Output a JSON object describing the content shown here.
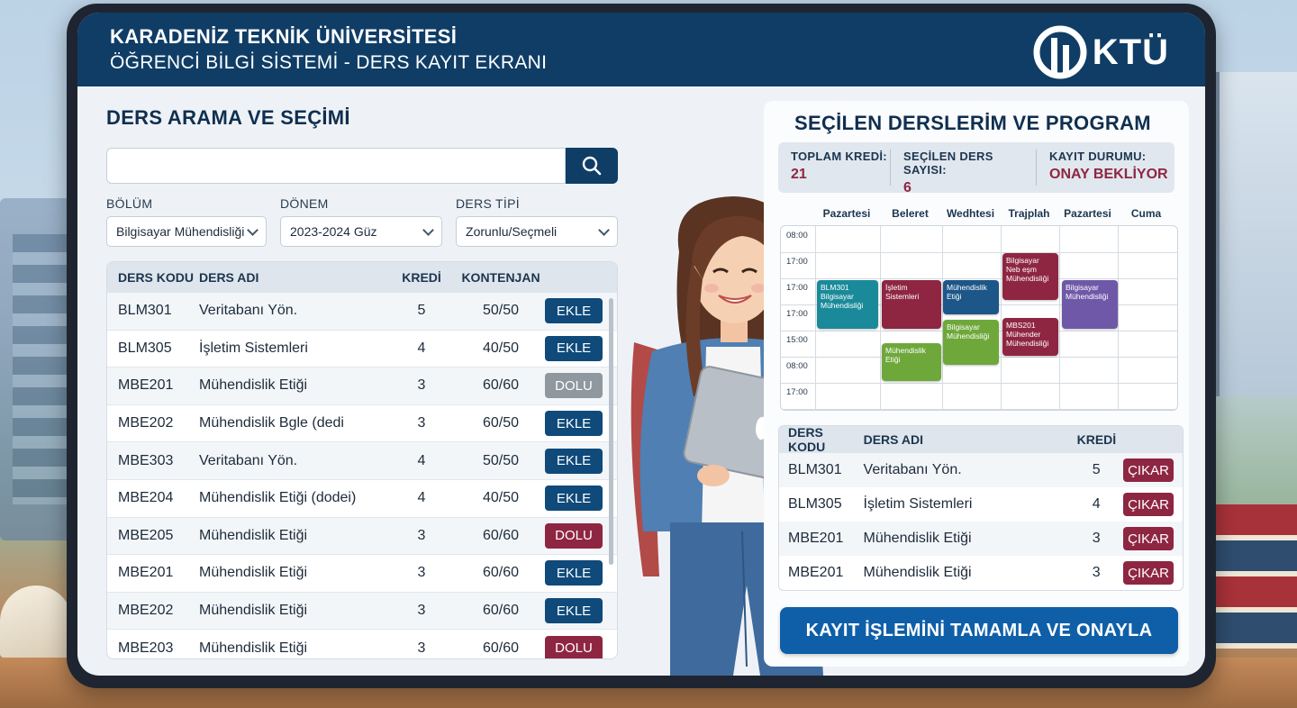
{
  "header": {
    "university": "KARADENİZ TEKNİK ÜNİVERSİTESİ",
    "system": "ÖĞRENCİ BİLGİ SİSTEMİ - DERS KAYIT EKRANI",
    "logo_text": "KTÜ"
  },
  "search_section": {
    "title": "DERS ARAMA VE SEÇİMİ",
    "search_value": "",
    "search_icon": "search-icon"
  },
  "filters": [
    {
      "label": "BÖLÜM",
      "value": "Bilgisayar Mühendisliği"
    },
    {
      "label": "DÖNEM",
      "value": "2023-2024 Güz"
    },
    {
      "label": "DERS TİPİ",
      "value": "Zorunlu/Seçmeli"
    }
  ],
  "course_table": {
    "headers": {
      "code": "DERS KODU",
      "name": "DERS ADI",
      "credit": "KREDİ",
      "quota": "KONTENJAN"
    },
    "rows": [
      {
        "code": "BLM301",
        "name": "Veritabanı Yön.",
        "credit": "5",
        "quota": "50/50",
        "action": "EKLE",
        "status": "add"
      },
      {
        "code": "BLM305",
        "name": "İşletim Sistemleri",
        "credit": "4",
        "quota": "40/50",
        "action": "EKLE",
        "status": "add"
      },
      {
        "code": "MBE201",
        "name": "Mühendislik Etiği",
        "credit": "3",
        "quota": "60/60",
        "action": "DOLU",
        "status": "full-gray"
      },
      {
        "code": "MBE202",
        "name": "Mühendislik Bgle (dedi",
        "credit": "3",
        "quota": "60/50",
        "action": "EKLE",
        "status": "add"
      },
      {
        "code": "MBE303",
        "name": "Veritabanı Yön.",
        "credit": "4",
        "quota": "50/50",
        "action": "EKLE",
        "status": "add"
      },
      {
        "code": "MBE204",
        "name": "Mühendislik Etiği (dodei)",
        "credit": "4",
        "quota": "40/50",
        "action": "EKLE",
        "status": "add"
      },
      {
        "code": "MBE205",
        "name": "Mühendislik Etiği",
        "credit": "3",
        "quota": "60/60",
        "action": "DOLU",
        "status": "full-red"
      },
      {
        "code": "MBE201",
        "name": "Mühendislik Etiği",
        "credit": "3",
        "quota": "60/60",
        "action": "EKLE",
        "status": "add"
      },
      {
        "code": "MBE202",
        "name": "Mühendislik Etiği",
        "credit": "3",
        "quota": "60/60",
        "action": "EKLE",
        "status": "add"
      },
      {
        "code": "MBE203",
        "name": "Mühendislik Etiği",
        "credit": "3",
        "quota": "60/60",
        "action": "DOLU",
        "status": "full-red"
      }
    ]
  },
  "selected_section": {
    "title": "SEÇİLEN DERSLERİM VE PROGRAM",
    "summary": [
      {
        "label": "TOPLAM KREDİ:",
        "value": "21"
      },
      {
        "label": "SEÇİLEN DERS SAYISI:",
        "value": "6"
      },
      {
        "label": "KAYIT DURUMU:",
        "value": "ONAY BEKLİYOR"
      }
    ]
  },
  "schedule": {
    "days": [
      "Pazartesi",
      "Beleret",
      "Wedhtesi",
      "Trajplah",
      "Pazartesi",
      "Cuma"
    ],
    "times": [
      "08:00",
      "17:00",
      "17:00",
      "17:00",
      "15:00",
      "08:00",
      "17:00"
    ],
    "blocks": [
      {
        "lines": [
          "BLM301",
          "Bilgisayar",
          "Mühendisliği"
        ],
        "color": "#1a8a9a"
      },
      {
        "lines": [
          "İşletim",
          "Sistemleri"
        ],
        "color": "#8e2642"
      },
      {
        "lines": [
          "Mühendislik",
          "Etiği"
        ],
        "color": "#6fa83a"
      },
      {
        "lines": [
          "Mühendislik",
          "Etiği"
        ],
        "color": "#1d5688"
      },
      {
        "lines": [
          "Bilgisayar",
          "Mühendisliği"
        ],
        "color": "#6fa83a"
      },
      {
        "lines": [
          "Bilgisayar",
          "Neb eşm",
          "Mühendisliği"
        ],
        "color": "#8e2642"
      },
      {
        "lines": [
          "MBS201",
          "Mühender",
          "Mühendisliği"
        ],
        "color": "#8e2642"
      },
      {
        "lines": [
          "Bilgisayar",
          "Mühendisliği"
        ],
        "color": "#7058a8"
      }
    ]
  },
  "selected_table": {
    "headers": {
      "code": "DERS KODU",
      "name": "DERS ADI",
      "credit": "KREDİ"
    },
    "rows": [
      {
        "code": "BLM301",
        "name": "Veritabanı Yön.",
        "credit": "5",
        "action": "ÇIKAR"
      },
      {
        "code": "BLM305",
        "name": "İşletim Sistemleri",
        "credit": "4",
        "action": "ÇIKAR"
      },
      {
        "code": "MBE201",
        "name": "Mühendislik Etiği",
        "credit": "3",
        "action": "ÇIKAR"
      },
      {
        "code": "MBE201",
        "name": "Mühendislik Etiği",
        "credit": "3",
        "action": "ÇIKAR"
      }
    ]
  },
  "confirm_button": "KAYIT İŞLEMİNİ TAMAMLA VE ONAYLA",
  "colors": {
    "primary": "#0f3d66",
    "accent_red": "#8e2642",
    "confirm": "#0f5fa8"
  }
}
